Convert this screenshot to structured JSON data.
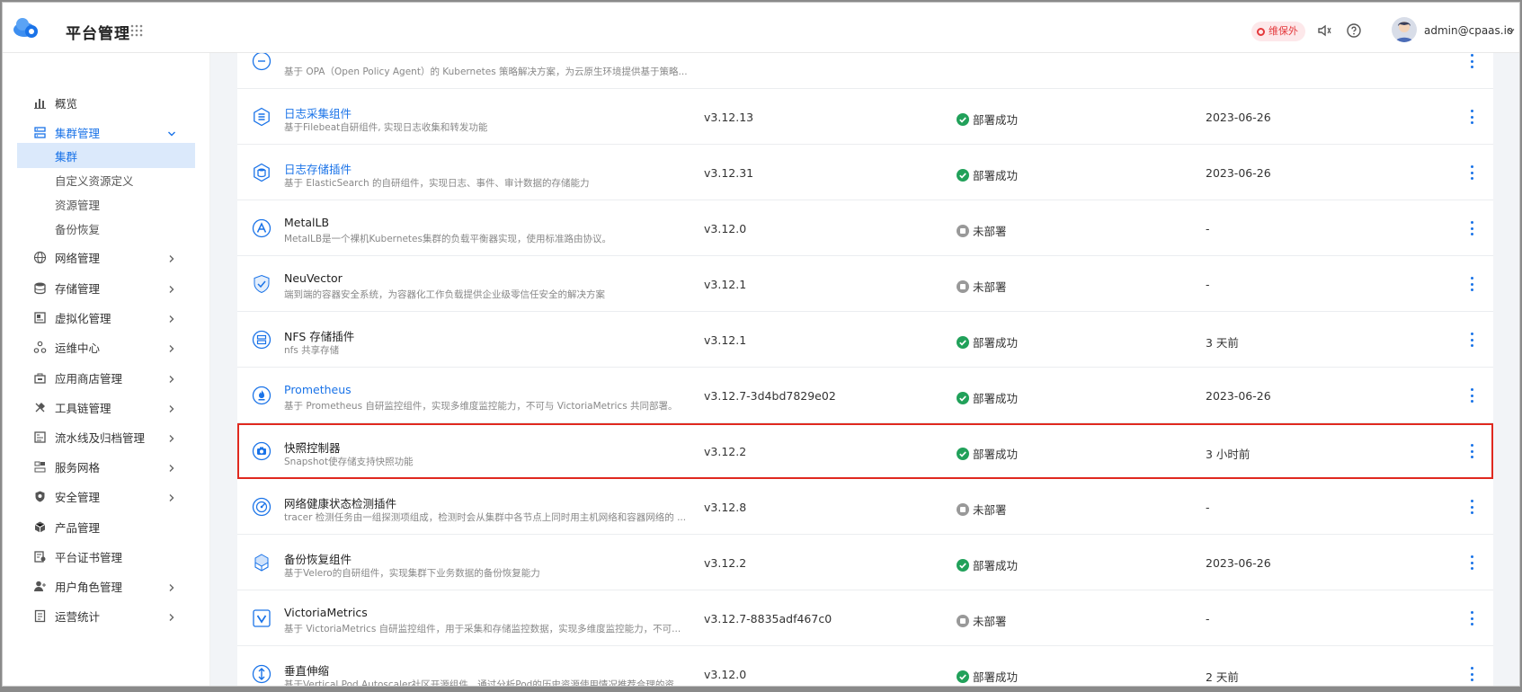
{
  "header": {
    "title": "平台管理",
    "badge": "维保外",
    "user": "admin@cpaas.io",
    "accent": "#1a73e8"
  },
  "sidebar": {
    "items": [
      {
        "label": "概览",
        "icon": "chart-icon",
        "chevron": false
      },
      {
        "label": "集群管理",
        "icon": "cluster-icon",
        "chevron": true,
        "active": true
      },
      {
        "label": "网络管理",
        "icon": "globe-icon",
        "chevron": true
      },
      {
        "label": "存储管理",
        "icon": "database-icon",
        "chevron": true
      },
      {
        "label": "虚拟化管理",
        "icon": "vm-icon",
        "chevron": true
      },
      {
        "label": "运维中心",
        "icon": "ops-icon",
        "chevron": true
      },
      {
        "label": "应用商店管理",
        "icon": "store-icon",
        "chevron": true
      },
      {
        "label": "工具链管理",
        "icon": "tools-icon",
        "chevron": true
      },
      {
        "label": "流水线及归档管理",
        "icon": "pipeline-icon",
        "chevron": true
      },
      {
        "label": "服务网格",
        "icon": "mesh-icon",
        "chevron": true
      },
      {
        "label": "安全管理",
        "icon": "shield-icon",
        "chevron": true
      },
      {
        "label": "产品管理",
        "icon": "box-icon",
        "chevron": false
      },
      {
        "label": "平台证书管理",
        "icon": "certificate-icon",
        "chevron": false
      },
      {
        "label": "用户角色管理",
        "icon": "user-icon",
        "chevron": true
      },
      {
        "label": "运营统计",
        "icon": "report-icon",
        "chevron": true
      }
    ],
    "sub_items": [
      "集群",
      "自定义资源定义",
      "资源管理",
      "备份恢复"
    ]
  },
  "rows": [
    {
      "name": "",
      "desc": "基于 OPA（Open Policy Agent）的 Kubernetes 策略解决方案，为云原生环境提供基于策略...",
      "version": "",
      "status": "",
      "date": "",
      "link": false,
      "icon": "policy-icon"
    },
    {
      "name": "日志采集组件",
      "desc": "基于Filebeat自研组件, 实现日志收集和转发功能",
      "version": "v3.12.13",
      "status": "部署成功",
      "ok": true,
      "date": "2023-06-26",
      "link": true,
      "icon": "log-collect-icon"
    },
    {
      "name": "日志存储插件",
      "desc": "基于 ElasticSearch 的自研组件，实现日志、事件、审计数据的存储能力",
      "version": "v3.12.31",
      "status": "部署成功",
      "ok": true,
      "date": "2023-06-26",
      "link": true,
      "icon": "log-storage-icon"
    },
    {
      "name": "MetalLB",
      "desc": "MetalLB是一个裸机Kubernetes集群的负载平衡器实现，使用标准路由协议。",
      "version": "v3.12.0",
      "status": "未部署",
      "ok": false,
      "date": "-",
      "link": false,
      "icon": "metallb-icon"
    },
    {
      "name": "NeuVector",
      "desc": "端到端的容器安全系统，为容器化工作负载提供企业级零信任安全的解决方案",
      "version": "v3.12.1",
      "status": "未部署",
      "ok": false,
      "date": "-",
      "link": false,
      "icon": "neuvector-icon"
    },
    {
      "name": "NFS 存储插件",
      "desc": "nfs 共享存储",
      "version": "v3.12.1",
      "status": "部署成功",
      "ok": true,
      "date": "3 天前",
      "link": false,
      "icon": "nfs-icon"
    },
    {
      "name": "Prometheus",
      "desc": "基于 Prometheus 自研监控组件，实现多维度监控能力，不可与 VictoriaMetrics 共同部署。",
      "version": "v3.12.7-3d4bd7829e02",
      "status": "部署成功",
      "ok": true,
      "date": "2023-06-26",
      "link": true,
      "icon": "prometheus-icon"
    },
    {
      "name": "快照控制器",
      "desc": "Snapshot使存储支持快照功能",
      "version": "v3.12.2",
      "status": "部署成功",
      "ok": true,
      "date": "3 小时前",
      "link": false,
      "icon": "camera-icon",
      "highlight": true
    },
    {
      "name": "网络健康状态检测插件",
      "desc": "tracer 检测任务由一组探测项组成，检测时会从集群中各节点上同时用主机网络和容器网络的 ...",
      "version": "v3.12.8",
      "status": "未部署",
      "ok": false,
      "date": "-",
      "link": false,
      "icon": "network-health-icon"
    },
    {
      "name": "备份恢复组件",
      "desc": "基于Velero的自研组件，实现集群下业务数据的备份恢复能力",
      "version": "v3.12.2",
      "status": "部署成功",
      "ok": true,
      "date": "2023-06-26",
      "link": false,
      "icon": "backup-icon"
    },
    {
      "name": "VictoriaMetrics",
      "desc": "基于 VictoriaMetrics 自研监控组件，用于采集和存储监控数据，实现多维度监控能力，不可...",
      "version": "v3.12.7-8835adf467c0",
      "status": "未部署",
      "ok": false,
      "date": "-",
      "link": false,
      "icon": "victoria-icon"
    },
    {
      "name": "垂直伸缩",
      "desc": "基于Vertical Pod Autoscaler社区开源组件，通过分析Pod的历史资源使用情况推荐合理的资源...",
      "version": "v3.12.0",
      "status": "部署成功",
      "ok": true,
      "date": "2 天前",
      "link": false,
      "icon": "vpa-icon"
    }
  ]
}
